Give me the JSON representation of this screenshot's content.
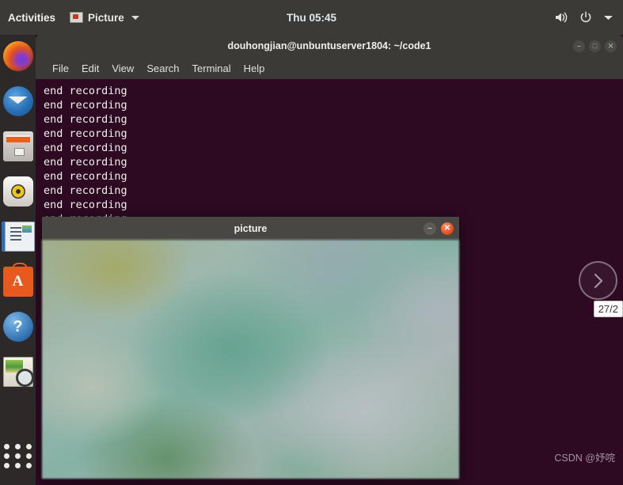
{
  "topbar": {
    "activities": "Activities",
    "app_name": "Picture",
    "app_icon": "picture-app-icon",
    "chevron_icon": "chevron-down-icon",
    "clock": "Thu 05:45",
    "tray": [
      {
        "name": "volume-icon",
        "label": "Volume"
      },
      {
        "name": "power-icon",
        "label": "Power"
      },
      {
        "name": "system-menu-chevron-icon",
        "label": "System menu"
      }
    ],
    "bg_color": "#3b3a36"
  },
  "dock": {
    "items": [
      {
        "name": "firefox-icon",
        "label": "Firefox"
      },
      {
        "name": "thunderbird-icon",
        "label": "Thunderbird Mail"
      },
      {
        "name": "files-icon",
        "label": "Files"
      },
      {
        "name": "rhythmbox-icon",
        "label": "Rhythmbox"
      },
      {
        "name": "libreoffice-writer-icon",
        "label": "LibreOffice Writer"
      },
      {
        "name": "ubuntu-software-icon",
        "label": "Ubuntu Software"
      },
      {
        "name": "help-icon",
        "label": "Help"
      },
      {
        "name": "image-viewer-icon",
        "label": "Image Viewer"
      },
      {
        "name": "show-applications-icon",
        "label": "Show Applications"
      }
    ]
  },
  "terminal": {
    "title": "douhongjian@unbuntuserver1804: ~/code1",
    "menu": [
      "File",
      "Edit",
      "View",
      "Search",
      "Terminal",
      "Help"
    ],
    "window_buttons": [
      {
        "name": "minimize-button",
        "glyph": "–"
      },
      {
        "name": "maximize-button",
        "glyph": "□"
      },
      {
        "name": "close-button",
        "glyph": "✕"
      }
    ],
    "output": "end recording\nend recording\nend recording\nend recording\nend recording\nend recording\nend recording\nend recording\nend recording\nend recording",
    "bg_color": "#2d0a22",
    "fg_color": "#f2f0ee"
  },
  "picture_window": {
    "title": "picture",
    "window_buttons": [
      {
        "name": "minimize-button",
        "glyph": "–"
      },
      {
        "name": "close-button",
        "glyph": "✕"
      }
    ]
  },
  "overlay": {
    "next_arrow_icon": "chevron-right-icon",
    "counter": "27/2"
  },
  "watermark": "CSDN @妤唍"
}
